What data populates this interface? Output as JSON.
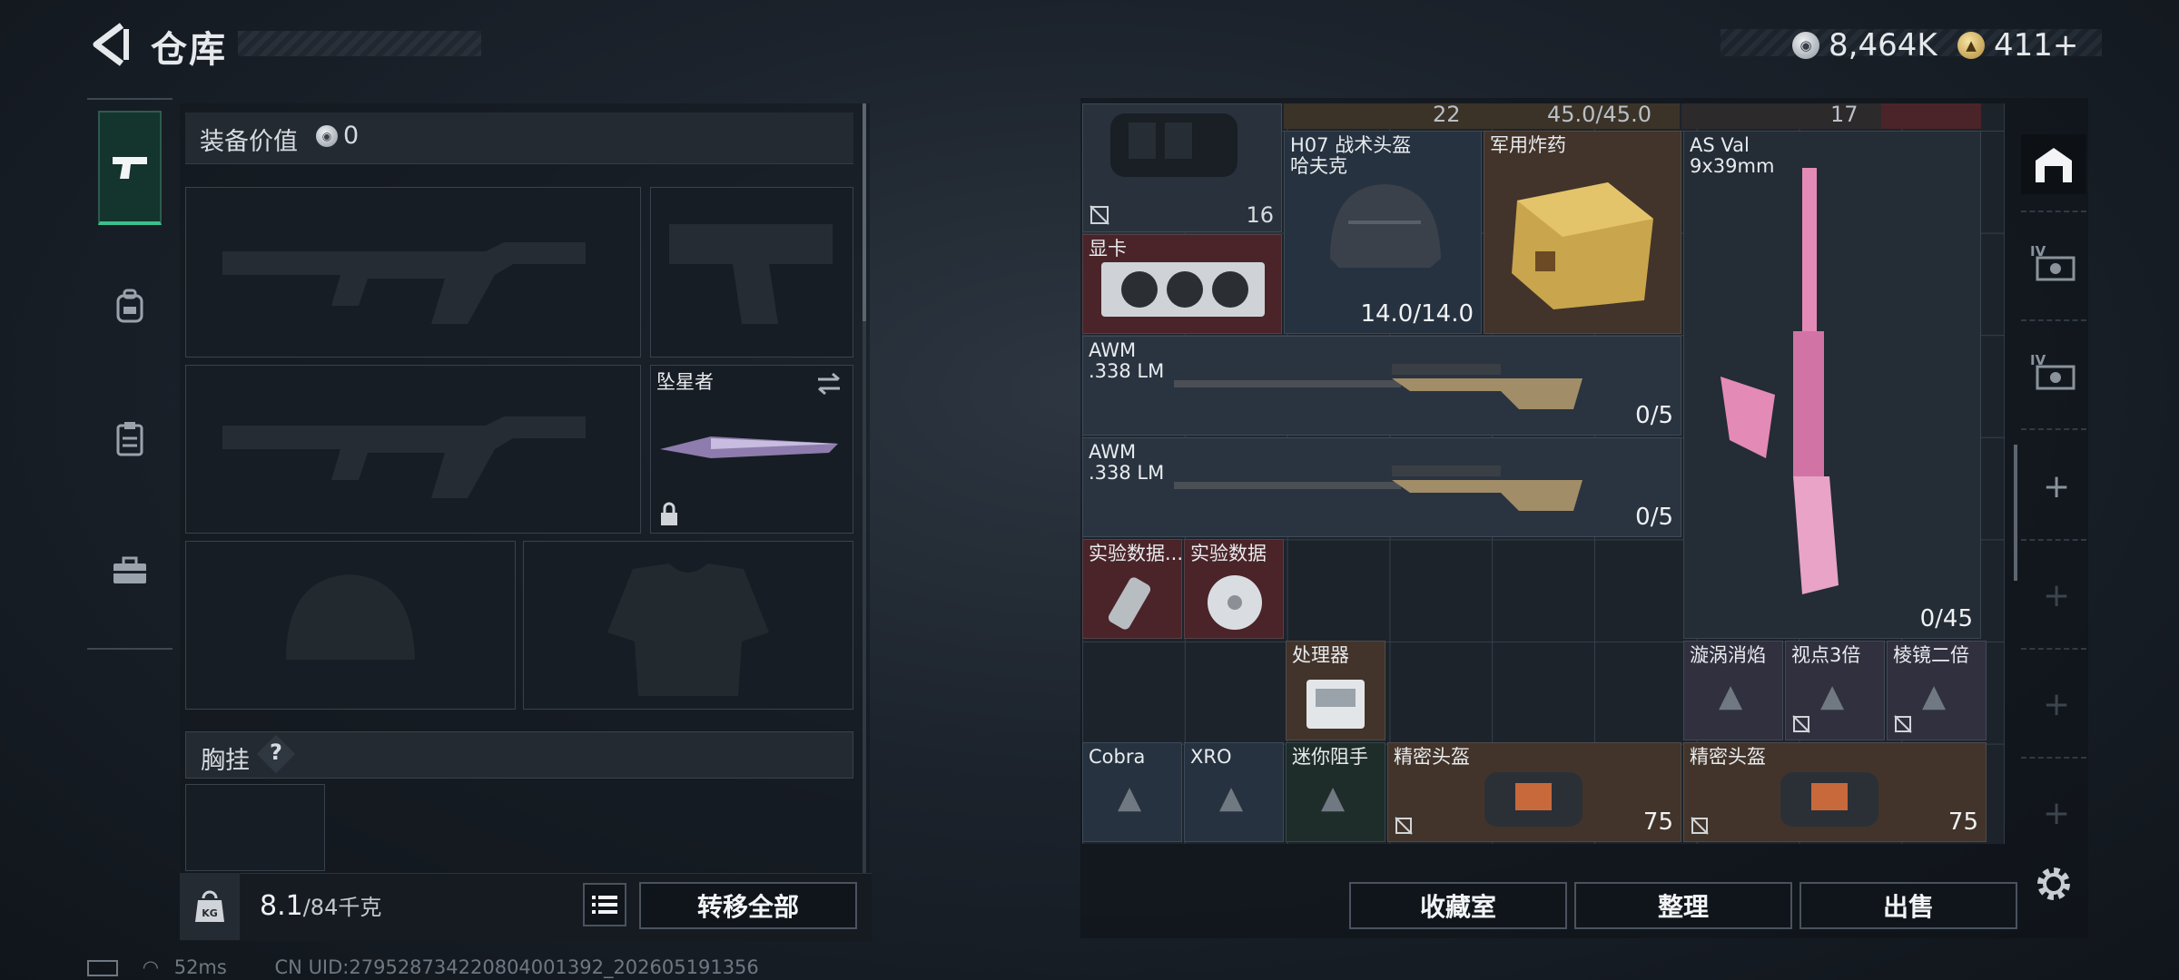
{
  "header": {
    "title": "仓库",
    "currency": [
      {
        "icon": "silver-coin-icon",
        "value": "8,464K"
      },
      {
        "icon": "gold-coin-icon",
        "value": "411+"
      }
    ]
  },
  "left": {
    "equip_value_label": "装备价值",
    "equip_value": "0",
    "melee_slot_label": "坠星者",
    "chest_rig_label": "胸挂",
    "chest_rig_help": "?",
    "weight_current": "8.1",
    "weight_max": "/84千克",
    "transfer_all": "转移全部"
  },
  "grid": {
    "items": [
      {
        "id": "bag",
        "name": "",
        "tag": "16",
        "tag_icon": "mark-icon"
      },
      {
        "id": "helmet",
        "name": "H07 战术头盔\n哈夫克",
        "count": "14.0/14.0"
      },
      {
        "id": "explosive",
        "name": "军用炸药",
        "count": ""
      },
      {
        "id": "asval",
        "name": "AS Val\n9x39mm",
        "count": "0/45"
      },
      {
        "id": "gpu",
        "name": "显卡"
      },
      {
        "id": "awm1",
        "name": "AWM\n.338 LM",
        "count": "0/5"
      },
      {
        "id": "awm2",
        "name": "AWM\n.338 LM",
        "count": "0/5"
      },
      {
        "id": "data1",
        "name": "实验数据..."
      },
      {
        "id": "data2",
        "name": "实验数据"
      },
      {
        "id": "cpu",
        "name": "处理器"
      },
      {
        "id": "vortex",
        "name": "漩涡消焰"
      },
      {
        "id": "sight3",
        "name": "视点3倍"
      },
      {
        "id": "prism2",
        "name": "棱镜二倍"
      },
      {
        "id": "cobra",
        "name": "Cobra"
      },
      {
        "id": "xro",
        "name": "XRO"
      },
      {
        "id": "mini",
        "name": "迷你阻手"
      },
      {
        "id": "pbag1",
        "name": "精密头盔",
        "count": "75"
      },
      {
        "id": "pbag2",
        "name": "精密头盔",
        "count": "75"
      }
    ],
    "top_row": {
      "a": "22",
      "b": "45.0/45.0",
      "c": "17"
    }
  },
  "right_buttons": {
    "collection": "收藏室",
    "arrange": "整理",
    "sell": "出售"
  },
  "status": {
    "ping": "52ms",
    "uid": "CN UID:279528734220804001392_202605191356"
  }
}
